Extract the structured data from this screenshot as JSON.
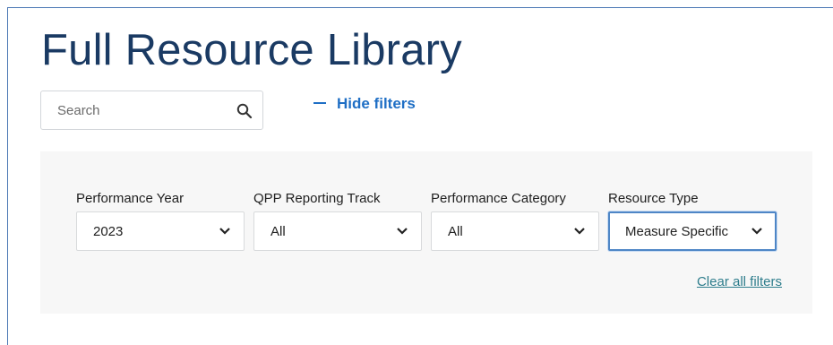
{
  "page": {
    "title": "Full Resource Library"
  },
  "search": {
    "placeholder": "Search",
    "value": ""
  },
  "toggle": {
    "hide_filters_label": "Hide filters"
  },
  "filters": [
    {
      "label": "Performance Year",
      "value": "2023"
    },
    {
      "label": "QPP Reporting Track",
      "value": "All"
    },
    {
      "label": "Performance Category",
      "value": "All"
    },
    {
      "label": "Resource Type",
      "value": "Measure Specific"
    }
  ],
  "clear_filters_label": "Clear all filters",
  "colors": {
    "title": "#1a3a63",
    "link": "#1f6fc5",
    "clear_link": "#2e7d8c",
    "panel_bg": "#f7f7f7",
    "active_border": "#4e86c6"
  }
}
